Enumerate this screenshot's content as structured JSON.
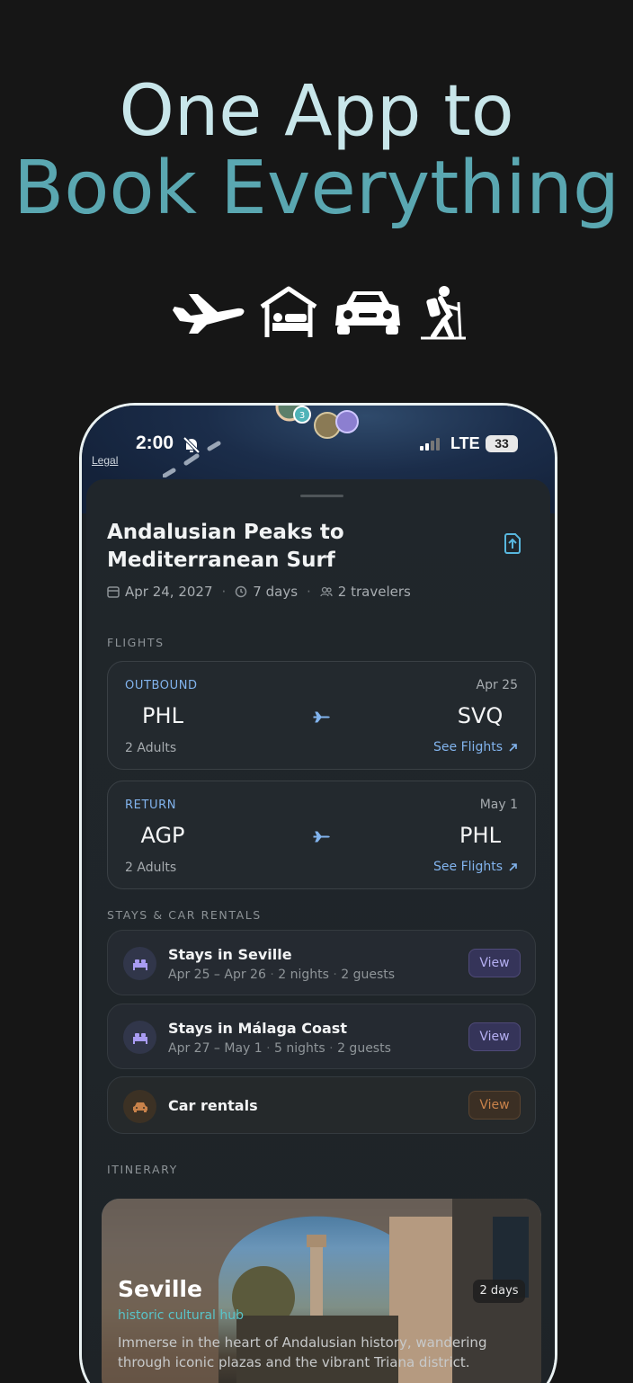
{
  "headline": {
    "line1": "One App to",
    "line2": "Book Everything"
  },
  "category_icons": [
    "plane-icon",
    "hotel-bed-icon",
    "car-icon",
    "hiker-icon"
  ],
  "status_bar": {
    "time": "2:00",
    "network": "LTE",
    "battery": "33"
  },
  "map": {
    "legal": "Legal",
    "pin_badge": "3"
  },
  "trip": {
    "title": "Andalusian Peaks to Mediterranean Surf",
    "date": "Apr 24, 2027",
    "duration": "7 days",
    "travelers": "2 travelers"
  },
  "flights": {
    "label": "FLIGHTS",
    "cards": [
      {
        "type": "OUTBOUND",
        "date": "Apr 25",
        "from": "PHL",
        "to": "SVQ",
        "adults": "2 Adults",
        "link": "See Flights"
      },
      {
        "type": "RETURN",
        "date": "May 1",
        "from": "AGP",
        "to": "PHL",
        "adults": "2 Adults",
        "link": "See Flights"
      }
    ]
  },
  "stays": {
    "label": "STAYS & CAR RENTALS",
    "items": [
      {
        "name": "Stays in Seville",
        "dates": "Apr 25 – Apr 26",
        "nights": "2 nights",
        "guests": "2 guests",
        "action": "View"
      },
      {
        "name": "Stays in Málaga Coast",
        "dates": "Apr 27 – May 1",
        "nights": "5 nights",
        "guests": "2 guests",
        "action": "View"
      }
    ],
    "car": {
      "name": "Car rentals",
      "action": "View"
    }
  },
  "itinerary": {
    "label": "ITINERARY",
    "city": {
      "name": "Seville",
      "days": "2 days",
      "tag": "historic cultural hub",
      "description": "Immerse in the heart of Andalusian history, wandering through iconic plazas and the vibrant Triana district."
    }
  },
  "colors": {
    "accent_teal": "#5aa7b1",
    "accent_blue": "#82b4ee",
    "accent_purple": "#b5aff2",
    "accent_orange": "#c9824a"
  }
}
